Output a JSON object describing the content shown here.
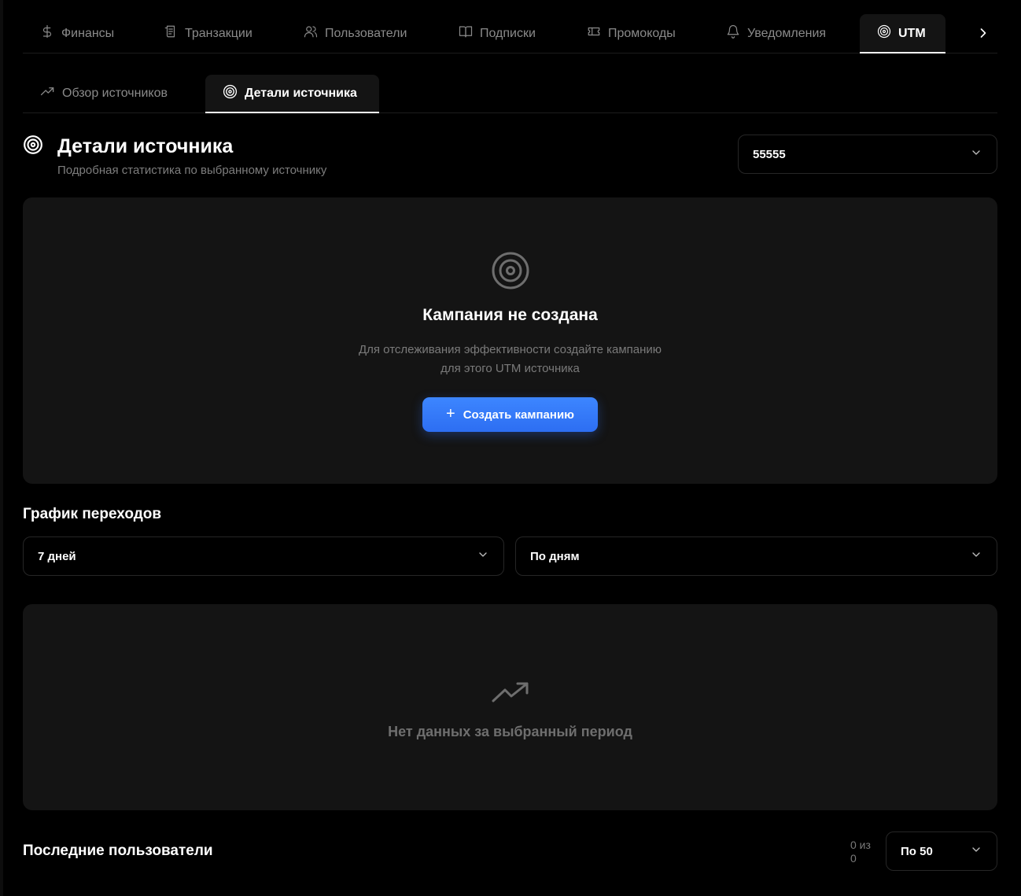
{
  "nav": {
    "items": [
      {
        "label": "Финансы",
        "icon": "dollar-icon"
      },
      {
        "label": "Транзакции",
        "icon": "receipt-icon"
      },
      {
        "label": "Пользователи",
        "icon": "users-icon"
      },
      {
        "label": "Подписки",
        "icon": "book-icon"
      },
      {
        "label": "Промокоды",
        "icon": "ticket-icon"
      },
      {
        "label": "Уведомления",
        "icon": "bell-icon"
      },
      {
        "label": "UTM",
        "icon": "target-icon",
        "active": true
      }
    ],
    "more_icon": "chevron-right-icon"
  },
  "subtabs": [
    {
      "label": "Обзор источников",
      "icon": "trending-up-icon"
    },
    {
      "label": "Детали источника",
      "icon": "target-icon",
      "active": true
    }
  ],
  "header": {
    "title": "Детали источника",
    "subtitle": "Подробная статистика по выбранному источнику",
    "source_select": "55555"
  },
  "campaign": {
    "title": "Кампания не создана",
    "desc_line1": "Для отслеживания эффективности создайте кампанию",
    "desc_line2": "для этого UTM источника",
    "button": "Создать кампанию"
  },
  "chart": {
    "title": "График переходов",
    "period_select": "7 дней",
    "group_select": "По дням",
    "empty": "Нет данных за выбранный период"
  },
  "users": {
    "title": "Последние пользователи",
    "count_line1": "0 из",
    "count_line2": "0",
    "per_page": "По 50"
  },
  "colors": {
    "background": "#000000",
    "card": "#141414",
    "accent": "#2d6ef2",
    "muted": "#7a7a7a"
  }
}
